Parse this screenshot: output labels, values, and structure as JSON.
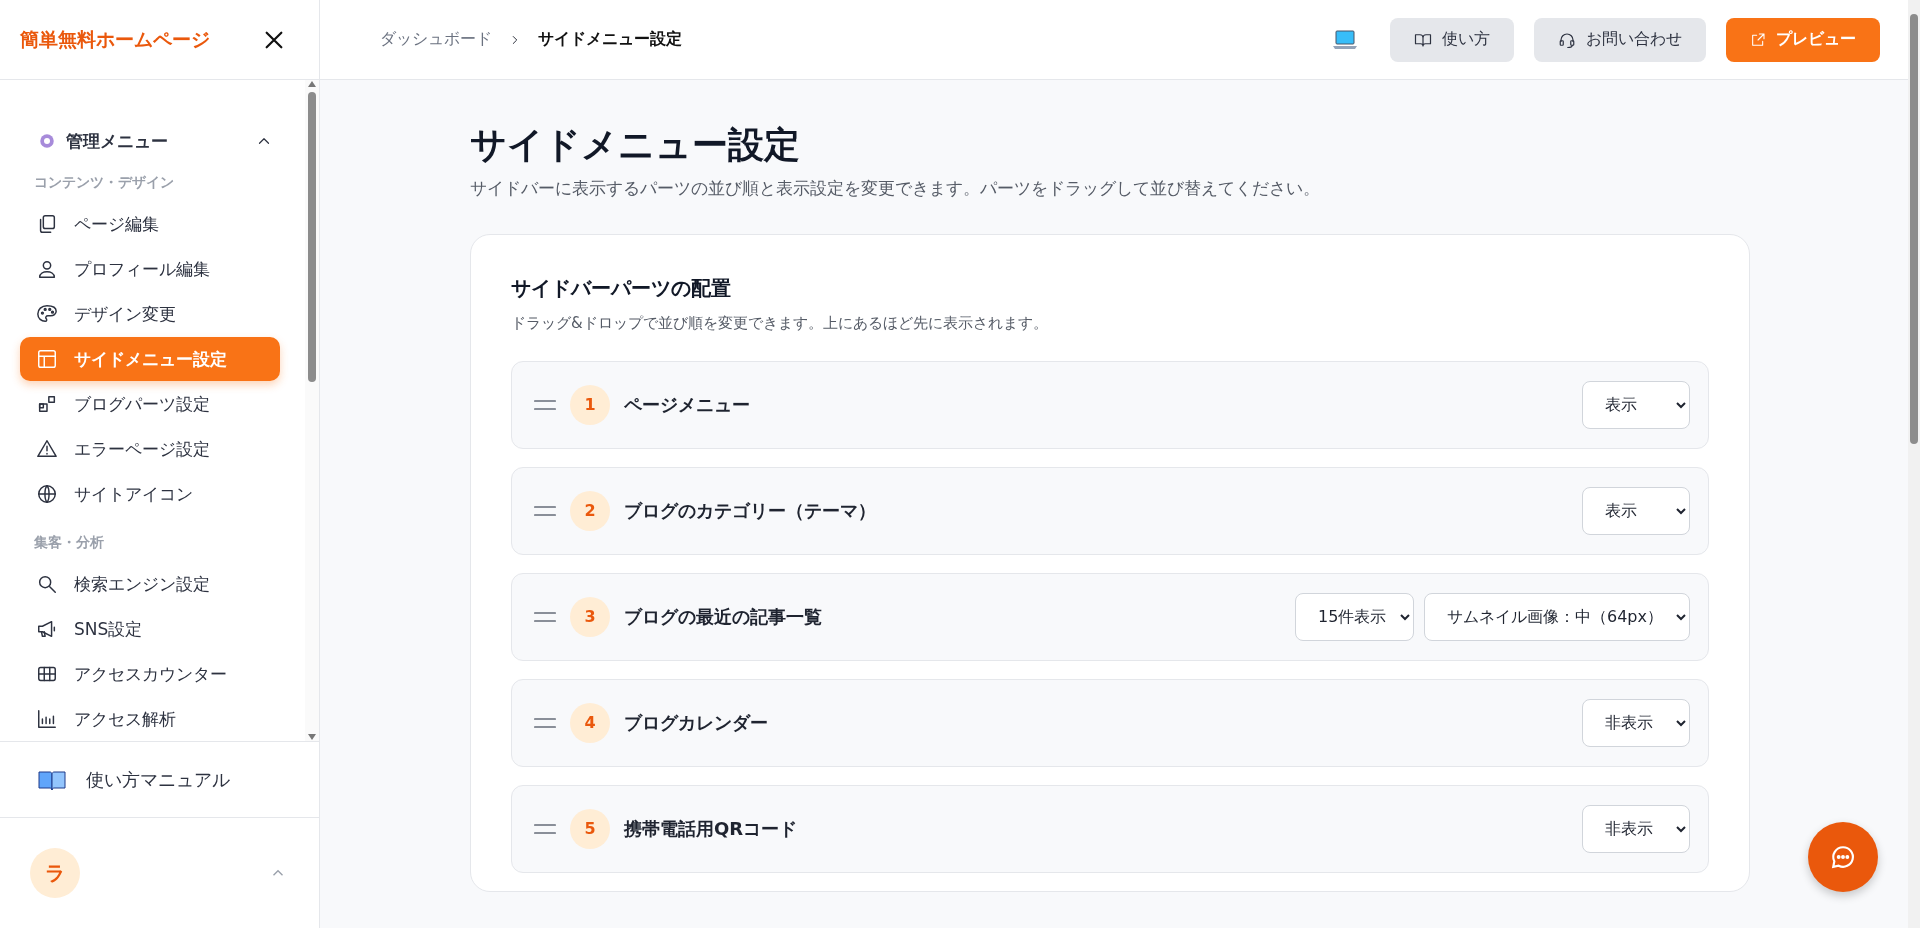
{
  "sidebar": {
    "logo": "簡単無料ホームページ",
    "menu": {
      "title": "管理メニュー",
      "expanded": true,
      "sections": [
        {
          "label": "コンテンツ・デザイン",
          "items": [
            {
              "label": "ページ編集",
              "selected": false
            },
            {
              "label": "プロフィール編集",
              "selected": false
            },
            {
              "label": "デザイン変更",
              "selected": false
            },
            {
              "label": "サイドメニュー設定",
              "selected": true
            },
            {
              "label": "ブログパーツ設定",
              "selected": false
            },
            {
              "label": "エラーページ設定",
              "selected": false
            },
            {
              "label": "サイトアイコン",
              "selected": false
            }
          ]
        },
        {
          "label": "集客・分析",
          "items": [
            {
              "label": "検索エンジン設定",
              "selected": false
            },
            {
              "label": "SNS設定",
              "selected": false
            },
            {
              "label": "アクセスカウンター",
              "selected": false
            },
            {
              "label": "アクセス解析",
              "selected": false
            }
          ]
        }
      ]
    },
    "manual": "使い方マニュアル",
    "user": {
      "initial": "ラ"
    }
  },
  "header": {
    "breadcrumb": [
      "ダッシュボード",
      "サイドメニュー設定"
    ],
    "buttons": [
      {
        "label": "使い方",
        "kind": "book"
      },
      {
        "label": "お問い合わせ",
        "kind": "headset"
      },
      {
        "label": "プレビュー",
        "kind": "external"
      }
    ]
  },
  "page": {
    "title": "サイドメニュー設定",
    "description": "サイドバーに表示するパーツの並び順と表示設定を変更できます。パーツをドラッグして並び替えてください。",
    "card": {
      "title": "サイドバーパーツの配置",
      "description": "ドラッグ&ドロップで並び順を変更できます。上にあるほど先に表示されます。",
      "parts": [
        {
          "number": "1",
          "name": "ページメニュー",
          "selects": [
            "表示"
          ]
        },
        {
          "number": "2",
          "name": "ブログのカテゴリー（テーマ）",
          "selects": [
            "表示"
          ]
        },
        {
          "number": "3",
          "name": "ブログの最近の記事一覧",
          "selects": [
            "15件表示",
            "サムネイル画像：中（64px）"
          ]
        },
        {
          "number": "4",
          "name": "ブログカレンダー",
          "selects": [
            "非表示"
          ]
        },
        {
          "number": "5",
          "name": "携帯電話用QRコード",
          "selects": [
            "非表示"
          ]
        }
      ]
    }
  }
}
